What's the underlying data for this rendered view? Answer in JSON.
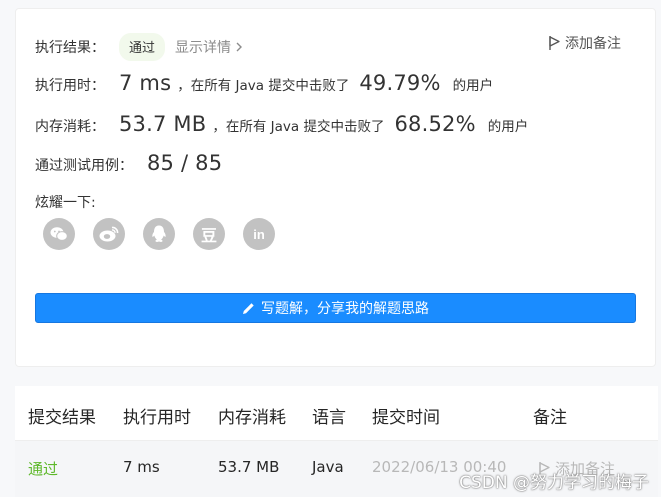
{
  "result": {
    "label": "执行结果：",
    "status": "通过",
    "details": "显示详情",
    "add_note": "添加备注"
  },
  "runtime": {
    "label": "执行用时：",
    "value": "7 ms",
    "mid": "，在所有 Java 提交中击败了",
    "percent": "49.79%",
    "suffix": "的用户"
  },
  "memory": {
    "label": "内存消耗：",
    "value": "53.7 MB",
    "mid": "，在所有 Java 提交中击败了",
    "percent": "68.52%",
    "suffix": "的用户"
  },
  "tests": {
    "label": "通过测试用例：",
    "value": "85 / 85"
  },
  "share": {
    "label": "炫耀一下:",
    "icons": [
      "wechat-icon",
      "weibo-icon",
      "qq-icon",
      "douban-icon",
      "linkedin-icon"
    ],
    "douban_glyph": "豆",
    "linkedin_glyph": "in"
  },
  "write_button": "写题解，分享我的解题思路",
  "table": {
    "headers": [
      "提交结果",
      "执行用时",
      "内存消耗",
      "语言",
      "提交时间",
      "备注"
    ],
    "row": {
      "result": "通过",
      "runtime": "7 ms",
      "memory": "53.7 MB",
      "language": "Java",
      "time": "2022/06/13 00:40",
      "note": "添加备注"
    }
  },
  "watermark": "CSDN @努力学习的梅子",
  "colors": {
    "accent": "#1a8cff",
    "pass": "#5eb82a",
    "badge_bg": "#f2f9ec"
  }
}
